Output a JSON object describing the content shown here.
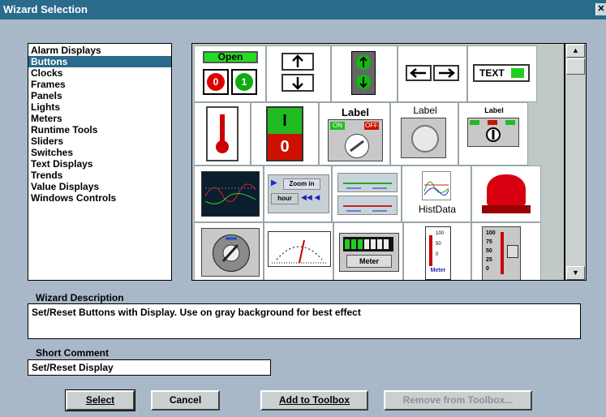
{
  "window": {
    "title": "Wizard Selection",
    "close_glyph": "✕"
  },
  "categories": [
    "Alarm Displays",
    "Buttons",
    "Clocks",
    "Frames",
    "Panels",
    "Lights",
    "Meters",
    "Runtime Tools",
    "Sliders",
    "Switches",
    "Text Displays",
    "Trends",
    "Value Displays",
    "Windows Controls"
  ],
  "selected_category": "Buttons",
  "gallery": {
    "open_label": "Open",
    "btn0": "0",
    "btn1": "1",
    "text_label": "TEXT",
    "label1": "Label",
    "on": "ON",
    "off": "OFF",
    "label2": "Label",
    "label3": "Label",
    "switch_i": "I",
    "switch_o": "0",
    "zoom_label": "Zoom in",
    "hour_label": "hour",
    "histdata_label": "HistData",
    "meter_label": "Meter",
    "gauge_ticks": [
      "100",
      "75",
      "50",
      "25",
      "0"
    ],
    "bar_ticks": [
      "100",
      "50",
      "0"
    ]
  },
  "description": {
    "label": "Wizard Description",
    "text": "Set/Reset Buttons with Display.  Use on gray background for best effect"
  },
  "short_comment": {
    "label": "Short Comment",
    "value": "Set/Reset Display"
  },
  "buttons": {
    "select": "Select",
    "cancel": "Cancel",
    "add": "Add to Toolbox",
    "remove": "Remove from Toolbox..."
  },
  "colors": {
    "title_bar": "#2a6a8a",
    "dialog_bg": "#a8b8c8",
    "selection": "#2a6a8a"
  }
}
